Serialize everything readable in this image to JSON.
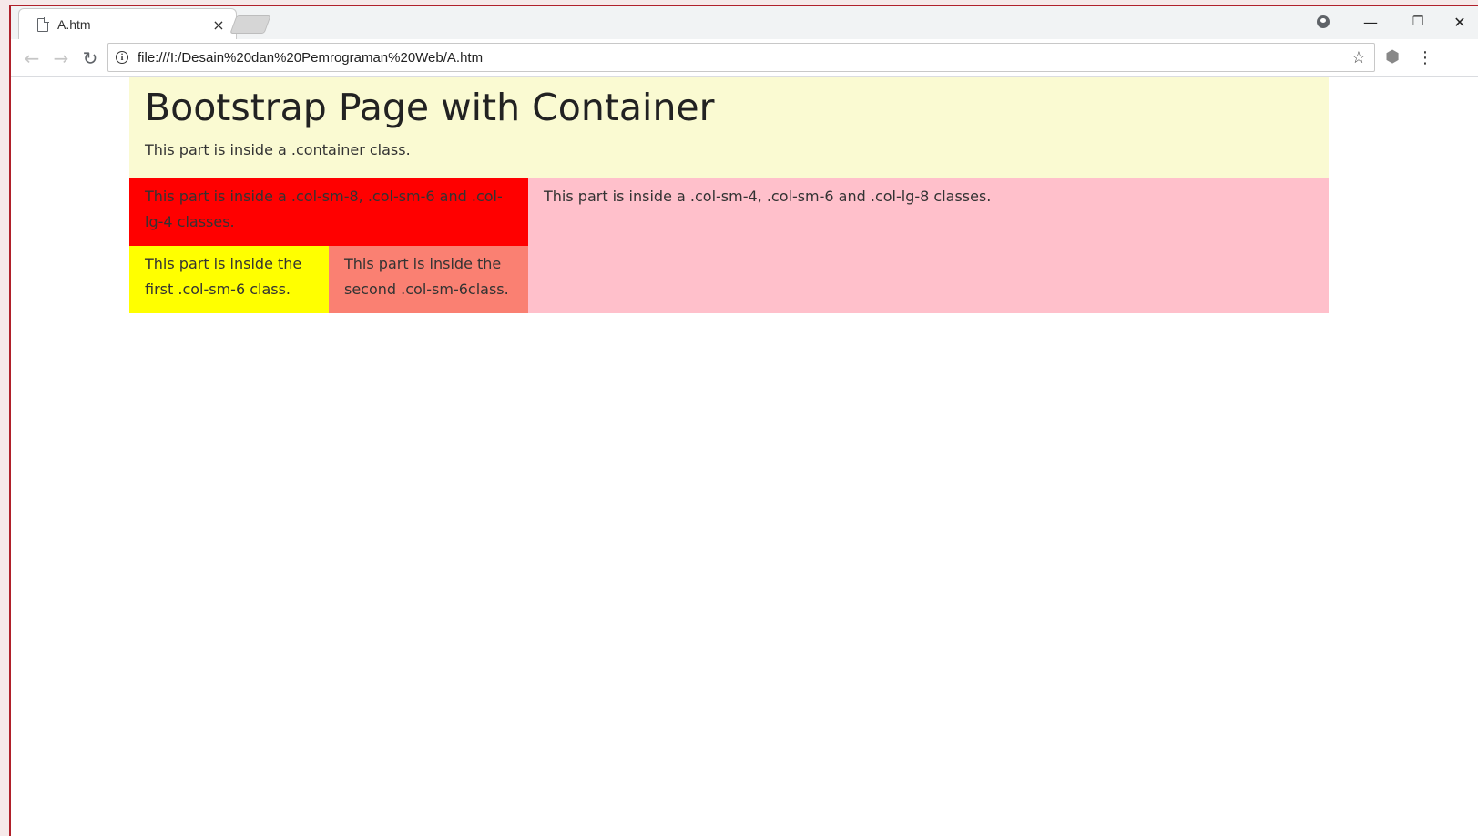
{
  "browser": {
    "tab_title": "A.htm",
    "tab_close": "×",
    "url": "file:///I:/Desain%20dan%20Pemrograman%20Web/A.htm",
    "icons": {
      "page": "document-icon",
      "back": "back-arrow-icon",
      "forward": "forward-arrow-icon",
      "reload": "reload-icon",
      "info": "info-icon",
      "star": "star-icon",
      "extension": "extension-icon",
      "menu": "menu-icon",
      "profile": "profile-icon",
      "minimize": "minimize-icon",
      "restore": "restore-icon",
      "close": "close-icon"
    }
  },
  "page": {
    "heading": "Bootstrap Page with Container",
    "container_text": "This part is inside a .container class.",
    "red_text": "This part is inside a .col-sm-8, .col-sm-6 and .col-lg-4 classes.",
    "pink_text": "This part is inside a .col-sm-4, .col-sm-6 and .col-lg-8 classes.",
    "yellow_text": "This part is inside the first .col-sm-6 class.",
    "salmon_text": "This part is inside the second .col-sm-6class."
  },
  "colors": {
    "jumbotron": "#fafad2",
    "red": "#ff0000",
    "pink": "#ffc0cb",
    "yellow": "#ffff00",
    "salmon": "#fa8072",
    "window_border": "#b0202a"
  }
}
